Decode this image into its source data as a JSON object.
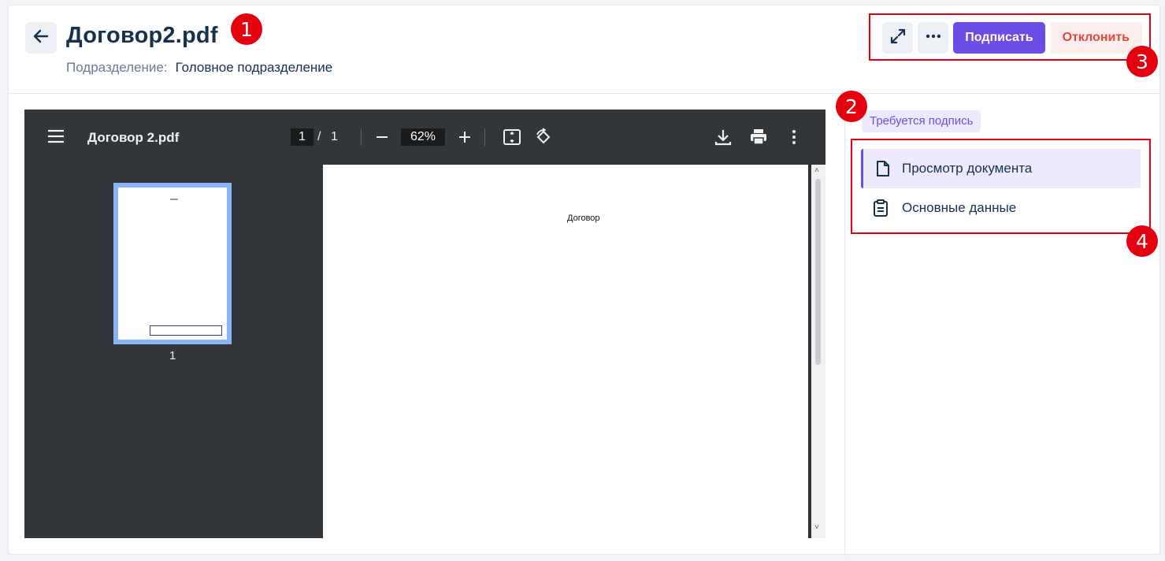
{
  "header": {
    "title": "Договор2.pdf",
    "subdivision_label": "Подразделение:",
    "subdivision_value": "Головное подразделение"
  },
  "actions": {
    "sign_label": "Подписать",
    "reject_label": "Отклонить"
  },
  "pdf_viewer": {
    "file_name": "Договор 2.pdf",
    "current_page": "1",
    "page_separator": "/",
    "total_pages": "1",
    "zoom": "62%",
    "thumbnail_page_number": "1",
    "document_heading": "Договор"
  },
  "sidebar": {
    "status_badge": "Требуется подпись",
    "items": [
      {
        "label": "Просмотр документа",
        "icon": "document-icon",
        "active": true
      },
      {
        "label": "Основные данные",
        "icon": "clipboard-icon",
        "active": false
      }
    ]
  },
  "annotations": {
    "markers": [
      "1",
      "2",
      "3",
      "4"
    ],
    "color": "#e4000f"
  },
  "colors": {
    "accent": "#6b4de6",
    "reject": "#e0483e",
    "title": "#16304f",
    "viewer_bg": "#323639"
  }
}
